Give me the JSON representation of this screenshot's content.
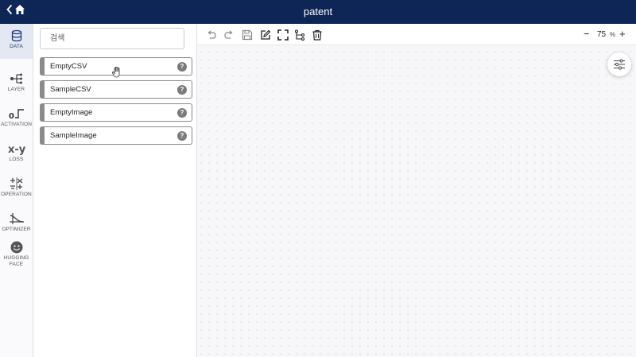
{
  "header": {
    "title": "patent",
    "back_icon": "chevron-left-icon",
    "home_icon": "home-icon"
  },
  "sidebar": {
    "items": [
      {
        "label": "DATA",
        "icon": "database-icon",
        "active": true
      },
      {
        "label": "LAYER",
        "icon": "layer-icon"
      },
      {
        "label": "ACTIVATION",
        "icon": "activation-icon"
      },
      {
        "label": "LOSS",
        "icon": "loss-icon",
        "glyph": "x-y"
      },
      {
        "label": "OPERATION",
        "icon": "operation-icon"
      },
      {
        "label": "OPTIMIZER",
        "icon": "optimizer-icon"
      },
      {
        "label": "HUGGING FACE",
        "icon": "hugging-face-icon"
      }
    ]
  },
  "panel": {
    "search_placeholder": "검색",
    "items": [
      {
        "label": "EmptyCSV"
      },
      {
        "label": "SampleCSV"
      },
      {
        "label": "EmptyImage"
      },
      {
        "label": "SampleImage"
      }
    ],
    "help_glyph": "?"
  },
  "toolbar": {
    "buttons": [
      "undo-icon",
      "redo-icon",
      "save-icon",
      "edit-icon",
      "fullscreen-icon",
      "branch-icon",
      "trash-icon"
    ],
    "zoom_minus": "−",
    "zoom_value": "75",
    "zoom_unit": "%",
    "zoom_plus": "+"
  },
  "activation_glyph": "0",
  "accent_color": "#0e2655"
}
